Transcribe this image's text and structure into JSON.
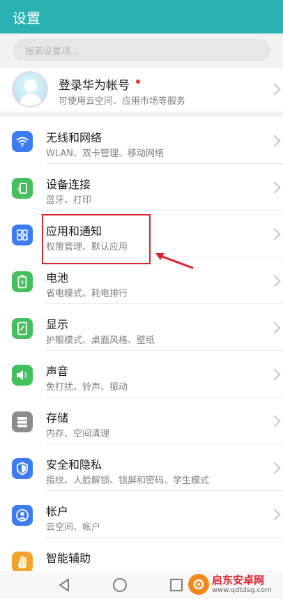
{
  "header": {
    "title": "设置"
  },
  "search": {
    "placeholder": "搜索设置项..."
  },
  "account": {
    "title": "登录华为帐号",
    "subtitle": "可使用云空间、应用市场等服务"
  },
  "settings": [
    {
      "title": "无线和网络",
      "subtitle": "WLAN、双卡管理、移动网络",
      "icon": "wifi-icon",
      "color": "#3d7cf0"
    },
    {
      "title": "设备连接",
      "subtitle": "蓝牙、打印",
      "icon": "device-connect-icon",
      "color": "#43c05b"
    },
    {
      "title": "应用和通知",
      "subtitle": "权限管理、默认应用",
      "icon": "apps-grid-icon",
      "color": "#3d7cf0"
    },
    {
      "title": "电池",
      "subtitle": "省电模式、耗电排行",
      "icon": "battery-icon",
      "color": "#43c05b"
    },
    {
      "title": "显示",
      "subtitle": "护眼模式、桌面风格、壁纸",
      "icon": "display-icon",
      "color": "#43c05b"
    },
    {
      "title": "声音",
      "subtitle": "免打扰、铃声、振动",
      "icon": "speaker-icon",
      "color": "#43c05b"
    },
    {
      "title": "存储",
      "subtitle": "内存、空间清理",
      "icon": "storage-icon",
      "color": "#8c8c8c"
    },
    {
      "title": "安全和隐私",
      "subtitle": "指纹、人脸解锁、锁屏和密码、学生模式",
      "icon": "shield-icon",
      "color": "#3d7cf0"
    },
    {
      "title": "帐户",
      "subtitle": "云空间、帐户",
      "icon": "account-icon",
      "color": "#3d7cf0"
    },
    {
      "title": "智能辅助",
      "subtitle": "",
      "icon": "hand-icon",
      "color": "#f3a52b"
    }
  ],
  "watermark": {
    "name": "启东安卓网",
    "url": "www.qdtdsg.com"
  },
  "colors": {
    "header": "#2ab1b3",
    "highlight": "#d9242b"
  }
}
